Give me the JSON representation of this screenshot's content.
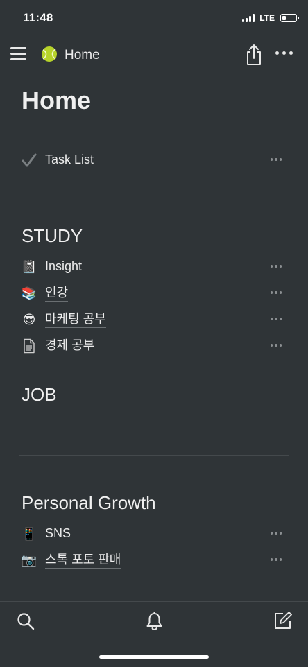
{
  "status_bar": {
    "time": "11:48",
    "network": "LTE",
    "battery_level": 0.3
  },
  "top_bar": {
    "page_icon": "tennis-ball-icon",
    "page_name": "Home"
  },
  "page": {
    "title": "Home",
    "task_list": {
      "icon": "checkmark-icon",
      "label": "Task List"
    },
    "sections": [
      {
        "heading": "STUDY",
        "items": [
          {
            "icon": "notebook-icon",
            "emoji": "📓",
            "label": "Insight"
          },
          {
            "icon": "books-icon",
            "emoji": "📚",
            "label": "인강"
          },
          {
            "icon": "sunglasses-face-icon",
            "emoji": "😎",
            "label": "마케팅 공부"
          },
          {
            "icon": "document-icon",
            "emoji": "",
            "label": "경제 공부"
          }
        ]
      },
      {
        "heading": "JOB",
        "items": []
      },
      {
        "heading": "Personal Growth",
        "items": [
          {
            "icon": "mobile-phone-icon",
            "emoji": "📱",
            "label": "SNS"
          },
          {
            "icon": "camera-icon",
            "emoji": "📷",
            "label": "스톡 포토 판매"
          }
        ]
      }
    ]
  },
  "bottom_bar": {
    "icons": [
      "search-icon",
      "bell-icon",
      "new-page-icon"
    ]
  }
}
